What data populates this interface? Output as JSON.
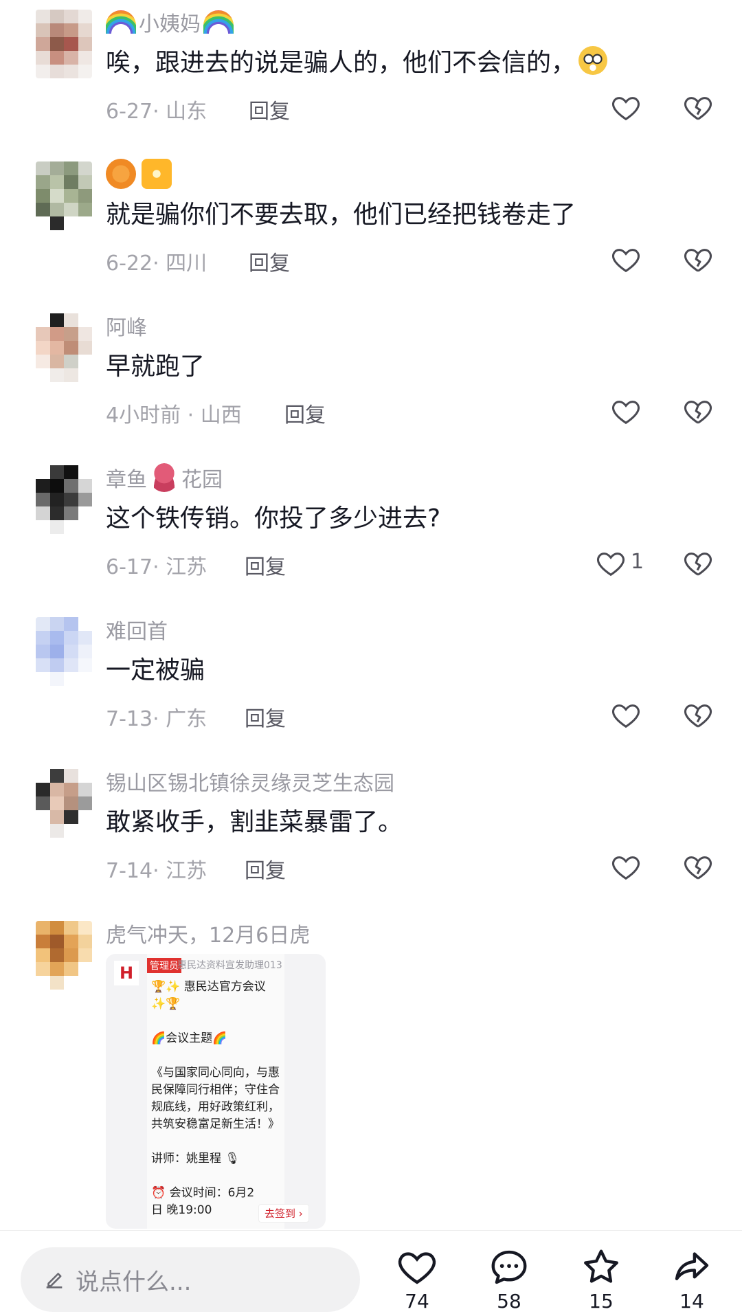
{
  "comments": [
    {
      "name_left_emoji": "rainbow",
      "username": "小姨妈",
      "name_right_emoji": "rainbow",
      "text": "唉，跟进去的说是骗人的，他们不会信的，",
      "text_emoji": "flushed-face",
      "meta": "6-27· 山东",
      "reply": "回复",
      "likes": ""
    },
    {
      "username": "",
      "badges": [
        "biohazard",
        "sparkle"
      ],
      "text": "就是骗你们不要去取，他们已经把钱卷走了",
      "meta": "6-22· 四川",
      "reply": "回复",
      "likes": ""
    },
    {
      "username": "阿峰",
      "text": "早就跑了",
      "meta": "4小时前 · 山西",
      "reply": "回复",
      "likes": ""
    },
    {
      "username_before": "章鱼",
      "username_emoji": "octopus",
      "username_after": "花园",
      "text": "这个铁传销。你投了多少进去?",
      "meta": "6-17· 江苏",
      "reply": "回复",
      "likes": "1"
    },
    {
      "username": "难回首",
      "text": "一定被骗",
      "meta": "7-13· 广东",
      "reply": "回复",
      "likes": ""
    },
    {
      "username": "锡山区锡北镇徐灵缘灵芝生态园",
      "text": "敢紧收手，割韭菜暴雷了。",
      "meta": "7-14· 江苏",
      "reply": "回复",
      "likes": ""
    },
    {
      "username": "虎气冲天，12月6日虎"
    }
  ],
  "attachment": {
    "admin_tag": "管理员",
    "sender": "惠民达资料宣发助理013",
    "logo_letter": "H",
    "text": "🏆✨ 惠民达官方会议\n✨🏆\n\n🌈会议主题🌈\n\n《与国家同心同向，与惠民保障同行相伴；守住合规底线，用好政策红利，共筑安稳富足新生活！》\n\n讲师：姚里程 🎙\n\n⏰ 会议时间：6月2\n日 晚19:00",
    "signin": "去签到 ›"
  },
  "bottom_bar": {
    "input_placeholder": "说点什么...",
    "likes": "74",
    "comments": "58",
    "favorites": "15",
    "shares": "14"
  },
  "colors": {
    "muted": "#9a9aa2",
    "text": "#161823",
    "reply": "#585862",
    "accent_red": "#d01f2a"
  }
}
